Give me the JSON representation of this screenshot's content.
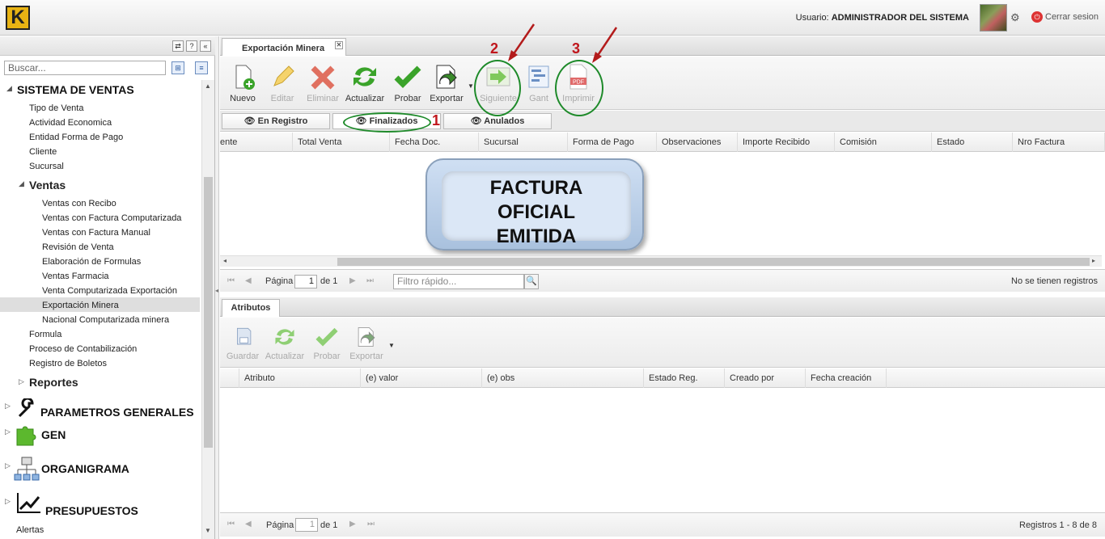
{
  "header": {
    "logo_letter": "K",
    "user_label": "Usuario:",
    "user_name": "ADMINISTRADOR DEL SISTEMA",
    "logout_label": "Cerrar sesion"
  },
  "sidebar": {
    "search_placeholder": "Buscar...",
    "items": [
      {
        "label": "SISTEMA DE VENTAS"
      },
      {
        "label": "Tipo de Venta"
      },
      {
        "label": "Actividad Economica"
      },
      {
        "label": "Entidad Forma de Pago"
      },
      {
        "label": "Cliente"
      },
      {
        "label": "Sucursal"
      },
      {
        "label": "Ventas"
      },
      {
        "label": "Ventas con Recibo"
      },
      {
        "label": "Ventas con Factura Computarizada"
      },
      {
        "label": "Ventas con Factura Manual"
      },
      {
        "label": "Revisión de Venta"
      },
      {
        "label": "Elaboración de Formulas"
      },
      {
        "label": "Ventas Farmacia"
      },
      {
        "label": "Venta Computarizada Exportación"
      },
      {
        "label": "Exportación Minera"
      },
      {
        "label": "Nacional Computarizada minera"
      },
      {
        "label": "Formula"
      },
      {
        "label": "Proceso de Contabilización"
      },
      {
        "label": "Registro de Boletos"
      },
      {
        "label": "Reportes"
      },
      {
        "label": "PARAMETROS GENERALES"
      },
      {
        "label": "GEN"
      },
      {
        "label": "ORGANIGRAMA"
      },
      {
        "label": "PRESUPUESTOS"
      },
      {
        "label": "Alertas"
      }
    ]
  },
  "main": {
    "tab_label": "Exportación Minera",
    "toolbar": [
      {
        "label": "Nuevo"
      },
      {
        "label": "Editar"
      },
      {
        "label": "Eliminar"
      },
      {
        "label": "Actualizar"
      },
      {
        "label": "Probar"
      },
      {
        "label": "Exportar"
      },
      {
        "label": "Siguiente"
      },
      {
        "label": "Gant"
      },
      {
        "label": "Imprimir"
      }
    ],
    "subtabs": [
      {
        "label": "En Registro"
      },
      {
        "label": "Finalizados"
      },
      {
        "label": "Anulados"
      }
    ],
    "columns": [
      "ente",
      "Total Venta",
      "Fecha Doc.",
      "Sucursal",
      "Forma de Pago",
      "Observaciones",
      "Importe Recibido",
      "Comisión",
      "Estado",
      "Nro Factura"
    ],
    "callout": [
      "FACTURA",
      "OFICIAL",
      "EMITIDA"
    ],
    "pager": {
      "page_label": "Página",
      "page_value": "1",
      "of_label": "de 1",
      "quick_filter_placeholder": "Filtro rápido...",
      "status": "No se tienen registros"
    },
    "annotations": [
      "1",
      "2",
      "3"
    ],
    "pdf_icon_text": "PDF"
  },
  "attributes": {
    "tab_label": "Atributos",
    "toolbar": [
      {
        "label": "Guardar"
      },
      {
        "label": "Actualizar"
      },
      {
        "label": "Probar"
      },
      {
        "label": "Exportar"
      }
    ],
    "columns": [
      "Atributo",
      "(e) valor",
      "(e) obs",
      "Estado Reg.",
      "Creado por",
      "Fecha creación"
    ],
    "pager": {
      "page_label": "Página",
      "page_value": "1",
      "of_label": "de 1",
      "status": "Registros 1 - 8 de 8"
    }
  }
}
